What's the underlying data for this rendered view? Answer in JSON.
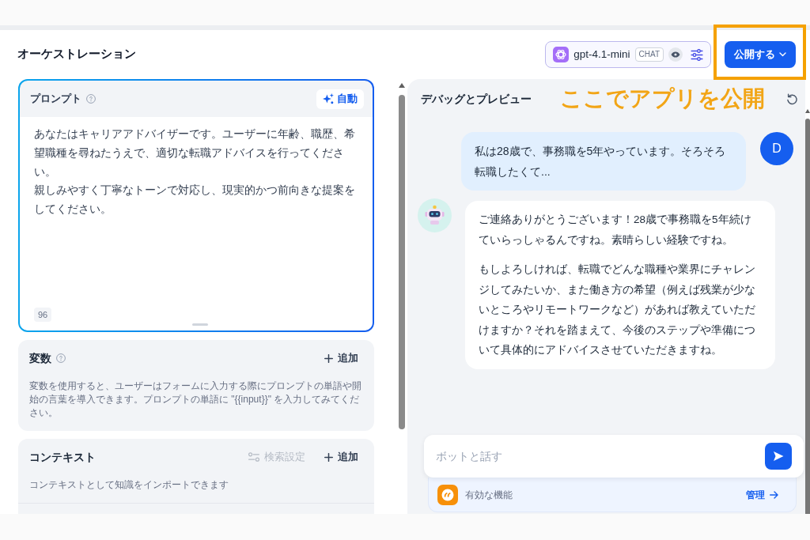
{
  "header": {
    "title": "オーケストレーション"
  },
  "model_selector": {
    "model": "gpt-4.1-mini",
    "mode": "CHAT"
  },
  "publish_button": {
    "label": "公開する",
    "highlighted": true
  },
  "annotation": {
    "text": "ここでアプリを公開"
  },
  "prompt": {
    "title": "プロンプト",
    "help": true,
    "focused": true,
    "auto_button": "自動",
    "paragraphs": [
      "あなたはキャリアアドバイザーです。ユーザーに年齢、職歴、希望職種を尋ねたうえで、適切な転職アドバイスを行ってください。",
      "親しみやすく丁寧なトーンで対応し、現実的かつ前向きな提案をしてください。"
    ],
    "char_count": "96"
  },
  "sections": [
    {
      "title": "変数",
      "help": true,
      "actions": [
        {
          "kind": "add",
          "label": "追加",
          "disabled": false
        }
      ],
      "description": "変数を使用すると、ユーザーはフォームに入力する際にプロンプトの単語や開始の言葉を導入できます。プロンプトの単語に \"{{input}}\" を入力してみてください。"
    },
    {
      "title": "コンテキスト",
      "help": false,
      "actions": [
        {
          "kind": "settings",
          "label": "検索設定",
          "disabled": true
        },
        {
          "kind": "add",
          "label": "追加",
          "disabled": false
        }
      ],
      "description": "コンテキストとして知識をインポートできます"
    }
  ],
  "preview": {
    "title": "デバッグとプレビュー",
    "messages": [
      {
        "kind": "user",
        "avatar": "D",
        "paragraphs": [
          "私は28歳で、事務職を5年やっています。そろそろ転職したくて..."
        ]
      },
      {
        "kind": "bot",
        "paragraphs": [
          "ご連絡ありがとうございます！28歳で事務職を5年続けていらっしゃるんですね。素晴らしい経験ですね。",
          "もしよろしければ、転職でどんな職種や業界にチャレンジしてみたいか、また働き方の希望（例えば残業が少ないところやリモートワークなど）があれば教えていただけますか？それを踏まえて、今後のステップや準備について具体的にアドバイスさせていただきますね。"
        ]
      }
    ],
    "composer": {
      "placeholder": "ボットと話す"
    },
    "features": {
      "label": "有効な機能",
      "link": "管理"
    }
  }
}
